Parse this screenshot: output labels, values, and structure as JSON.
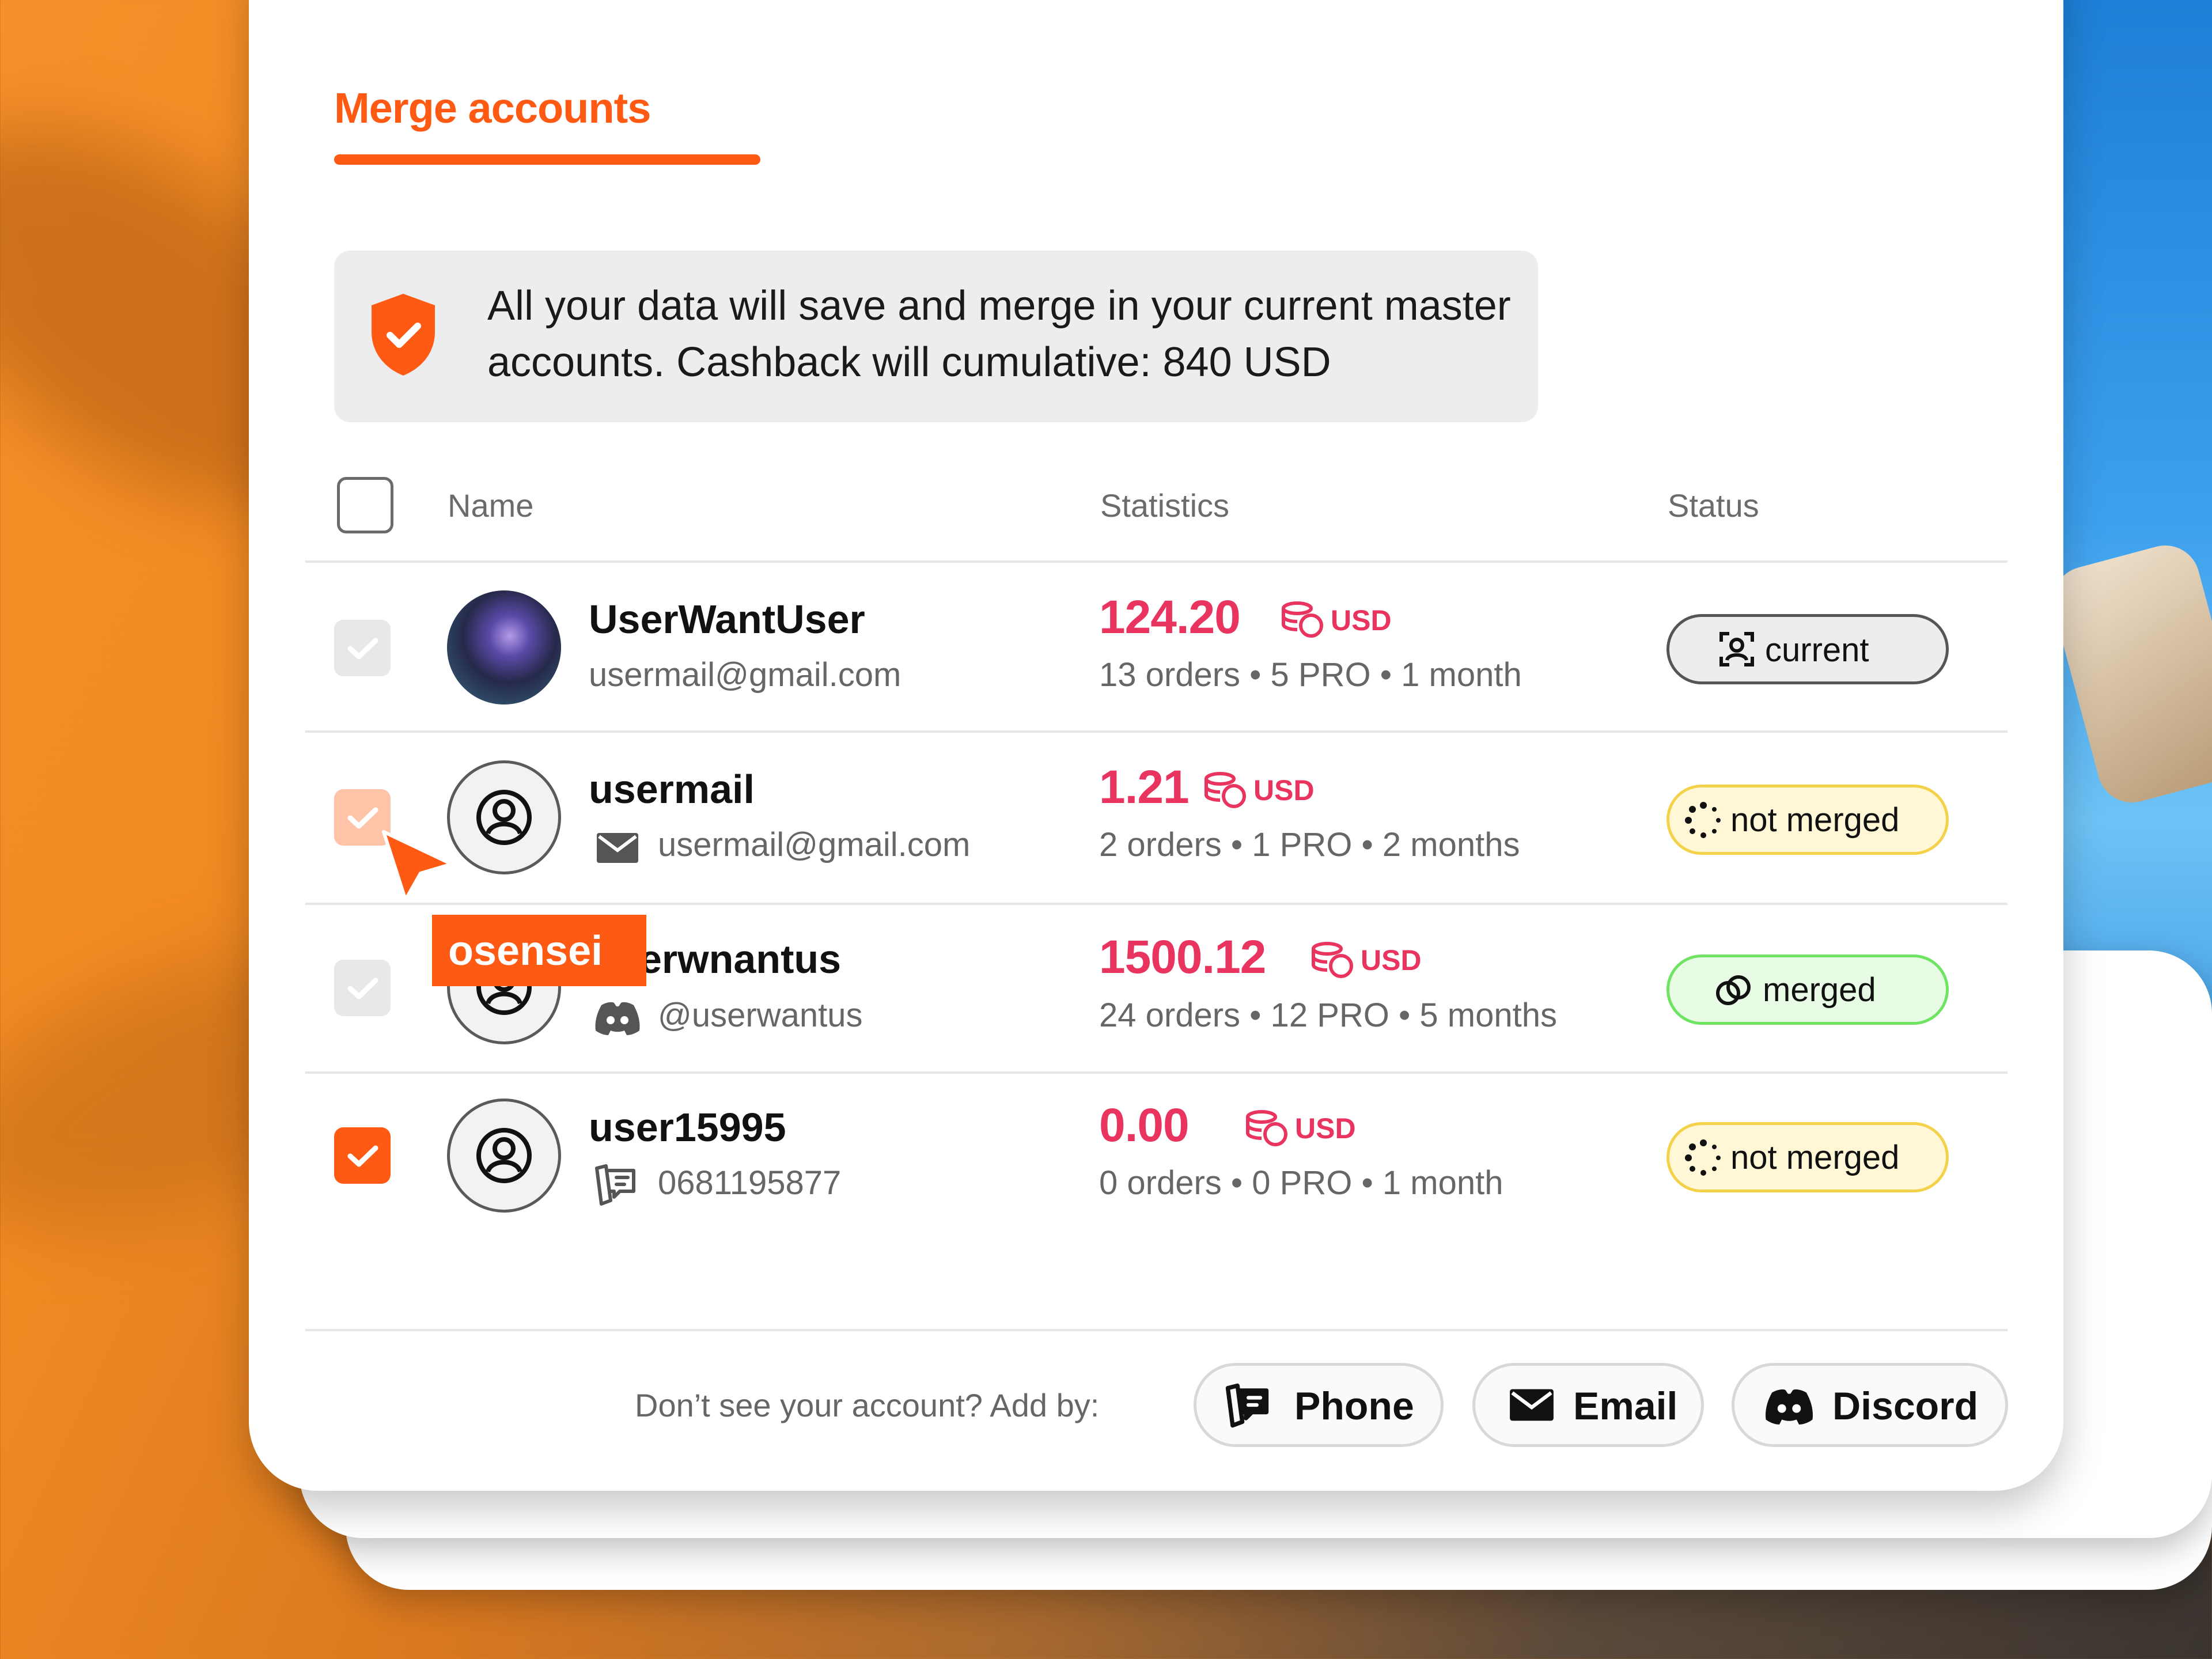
{
  "tab": {
    "title": "Merge accounts"
  },
  "info": {
    "text": "All your data will save and merge in your current master accounts. Cashback will cumulative: 840 USD"
  },
  "columns": {
    "name": "Name",
    "statistics": "Statistics",
    "status": "Status"
  },
  "rows": [
    {
      "name": "UserWantUser",
      "sub": "usermail@gmail.com",
      "amount": "124.20",
      "currency": "USD",
      "stats": "13 orders • 5 PRO • 1 month",
      "status": "current",
      "checked": "disabled"
    },
    {
      "name": "usermail",
      "sub": "usermail@gmail.com",
      "amount": "1.21",
      "currency": "USD",
      "stats": "2 orders • 1 PRO • 2 months",
      "status": "not merged",
      "checked": "hover"
    },
    {
      "name": "erwnantus",
      "sub": "@userwantus",
      "amount": "1500.12",
      "currency": "USD",
      "stats": "24 orders • 12 PRO • 5 months",
      "status": "merged",
      "checked": "disabled"
    },
    {
      "name": "user15995",
      "sub": "0681195877",
      "amount": "0.00",
      "currency": "USD",
      "stats": "0 orders • 0 PRO • 1 month",
      "status": "not merged",
      "checked": "on"
    }
  ],
  "cursor_tag": "osensei",
  "footer": {
    "prompt": "Don’t see your account? Add by:",
    "buttons": {
      "phone": "Phone",
      "email": "Email",
      "discord": "Discord"
    }
  },
  "colors": {
    "accent": "#ff5a14",
    "amount": "#e8345e",
    "merged": "#6ee462",
    "not_merged": "#f3d24a"
  }
}
